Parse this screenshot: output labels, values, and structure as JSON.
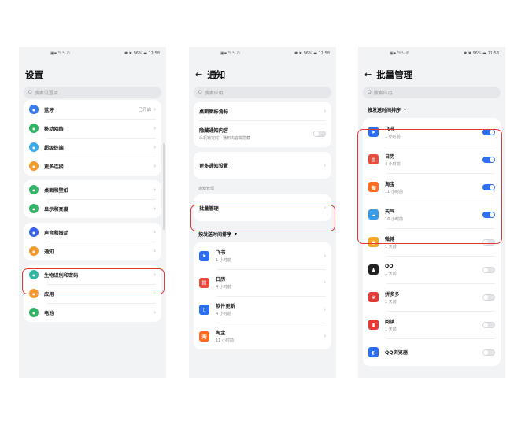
{
  "status": {
    "left": "▣▪ ⁵ᵍ ᵃᵢₗ ✆",
    "right": "✱ ✖ 96% ▬ 11:58"
  },
  "p1": {
    "title": "设置",
    "search_placeholder": "搜索设置项",
    "group1": [
      {
        "label": "蓝牙",
        "value": "已开启",
        "color": "#3a7bf0",
        "icon": "bluetooth-icon"
      },
      {
        "label": "移动网络",
        "value": "",
        "color": "#2fb564",
        "icon": "mobile-network-icon"
      },
      {
        "label": "超级终端",
        "value": "",
        "color": "#3aa9e8",
        "icon": "super-device-icon"
      },
      {
        "label": "更多连接",
        "value": "",
        "color": "#f39a2b",
        "icon": "more-connections-icon"
      }
    ],
    "group2": [
      {
        "label": "桌面和壁纸",
        "color": "#2fb564",
        "icon": "wallpaper-icon"
      },
      {
        "label": "显示和亮度",
        "color": "#2fb564",
        "icon": "brightness-icon"
      }
    ],
    "group3": [
      {
        "label": "声音和振动",
        "color": "#3a64e8",
        "icon": "sound-icon"
      },
      {
        "label": "通知",
        "color": "#f39a2b",
        "icon": "notification-bell-icon"
      }
    ],
    "group4": [
      {
        "label": "生物识别和密码",
        "color": "#2fb5a2",
        "icon": "biometrics-icon"
      },
      {
        "label": "应用",
        "color": "#f39a2b",
        "icon": "apps-icon"
      },
      {
        "label": "电池",
        "color": "#2fb564",
        "icon": "battery-icon"
      }
    ]
  },
  "p2": {
    "title": "通知",
    "search_placeholder": "搜索应用",
    "badge_row": "桌面图标角标",
    "hide_row": "隐藏通知内容",
    "hide_row_sub": "手机锁定时，通知内容将隐藏",
    "more_settings": "更多通知设置",
    "manage_label": "通知管理",
    "batch_manage": "批量管理",
    "sort_label": "按发送时间排序",
    "apps": [
      {
        "name": "飞书",
        "time": "1 小时前",
        "color": "#2b6ff0",
        "icon": "feishu-icon",
        "glyph": "➤"
      },
      {
        "name": "日历",
        "time": "4 小时前",
        "color": "#e74c3c",
        "icon": "calendar-icon",
        "glyph": "▤"
      },
      {
        "name": "软件更新",
        "time": "4 小时前",
        "color": "#2b6ff0",
        "icon": "software-update-icon",
        "glyph": "▯"
      },
      {
        "name": "淘宝",
        "time": "11 小时前",
        "color": "#ff6a1f",
        "icon": "taobao-icon",
        "glyph": "淘"
      }
    ]
  },
  "p3": {
    "title": "批量管理",
    "search_placeholder": "搜索应用",
    "sort_label": "按发送时间排序",
    "apps": [
      {
        "name": "飞书",
        "time": "1 小时前",
        "color": "#2b6ff0",
        "icon": "feishu-icon",
        "glyph": "➤",
        "on": true
      },
      {
        "name": "日历",
        "time": "4 小时前",
        "color": "#e74c3c",
        "icon": "calendar-icon",
        "glyph": "▤",
        "on": true
      },
      {
        "name": "淘宝",
        "time": "11 小时前",
        "color": "#ff6a1f",
        "icon": "taobao-icon",
        "glyph": "淘",
        "on": true
      },
      {
        "name": "天气",
        "time": "16 小时前",
        "color": "#3a9be8",
        "icon": "weather-icon",
        "glyph": "☁",
        "on": true
      },
      {
        "name": "微博",
        "time": "1 天前",
        "color": "#f5a623",
        "icon": "weibo-icon",
        "glyph": "◉",
        "on": false
      },
      {
        "name": "QQ",
        "time": "1 天前",
        "color": "#222222",
        "icon": "qq-icon",
        "glyph": "♟",
        "on": false
      },
      {
        "name": "拼多多",
        "time": "1 天前",
        "color": "#e53935",
        "icon": "pinduoduo-icon",
        "glyph": "❀",
        "on": false
      },
      {
        "name": "阅读",
        "time": "1 天前",
        "color": "#e53935",
        "icon": "reading-icon",
        "glyph": "▮",
        "on": false
      },
      {
        "name": "QQ浏览器",
        "time": "",
        "color": "#2b6ff0",
        "icon": "qq-browser-icon",
        "glyph": "◐",
        "on": false
      }
    ]
  },
  "colors": {
    "highlight": "#e53935",
    "toggle_on": "#2f6ff2"
  }
}
